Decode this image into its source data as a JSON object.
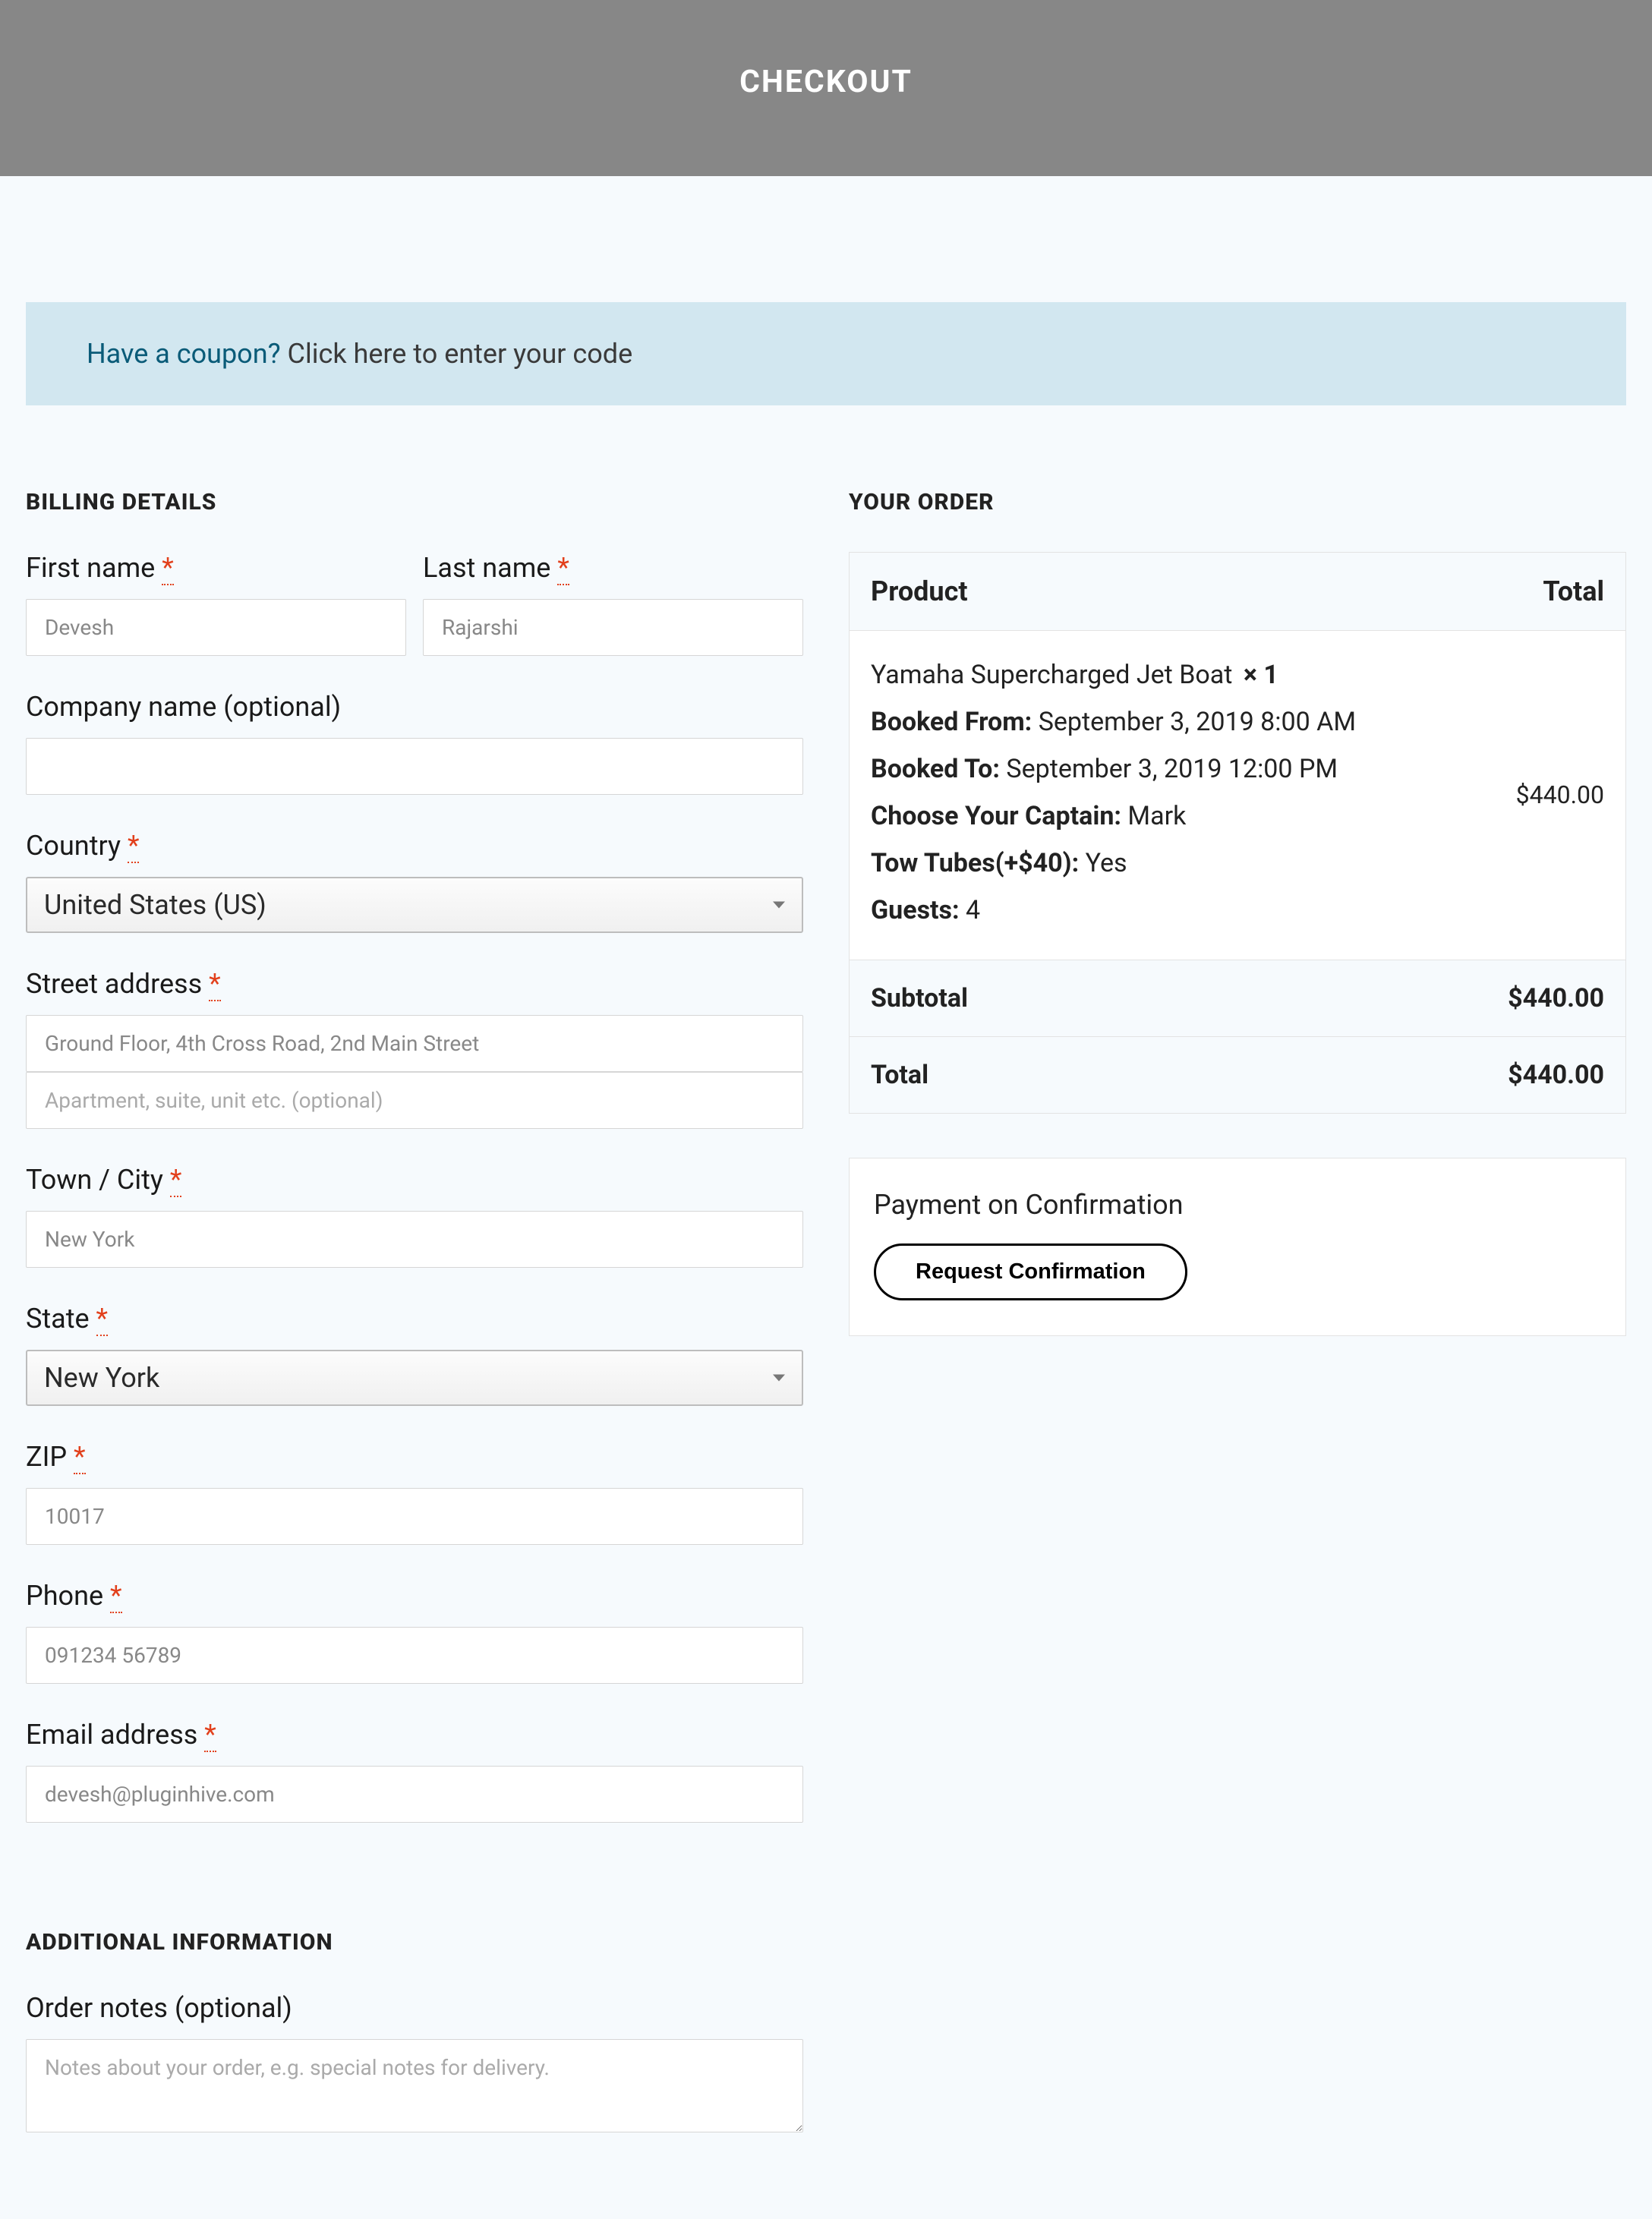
{
  "header": {
    "title": "CHECKOUT"
  },
  "coupon": {
    "link_text": "Have a coupon?",
    "prompt_text": " Click here to enter your code"
  },
  "sections": {
    "billing_title": "BILLING DETAILS",
    "additional_title": "ADDITIONAL INFORMATION",
    "order_title": "YOUR ORDER"
  },
  "billing": {
    "first_name_label": "First name ",
    "first_name_value": "Devesh",
    "last_name_label": "Last name ",
    "last_name_value": "Rajarshi",
    "company_label": "Company name (optional)",
    "company_value": "",
    "country_label": "Country ",
    "country_value": "United States (US)",
    "street_label": "Street address ",
    "street_value_1": "Ground Floor, 4th Cross Road, 2nd Main Street",
    "street_placeholder_2": "Apartment, suite, unit etc. (optional)",
    "city_label": "Town / City ",
    "city_value": "New York",
    "state_label": "State ",
    "state_value": "New York",
    "zip_label": "ZIP ",
    "zip_value": "10017",
    "phone_label": "Phone ",
    "phone_value": "091234 56789",
    "email_label": "Email address ",
    "email_value": "devesh@pluginhive.com",
    "required_mark": "*"
  },
  "additional": {
    "notes_label": "Order notes (optional)",
    "notes_placeholder": "Notes about your order, e.g. special notes for delivery."
  },
  "order": {
    "head_product": "Product",
    "head_total": "Total",
    "product": {
      "name": "Yamaha Supercharged Jet Boat ",
      "qty": " × 1",
      "booked_from_label": "Booked From: ",
      "booked_from_value": "September 3, 2019 8:00 AM",
      "booked_to_label": "Booked To: ",
      "booked_to_value": "September 3, 2019 12:00 PM",
      "captain_label": "Choose Your Captain: ",
      "captain_value": "Mark",
      "tubes_label": "Tow Tubes(+$40): ",
      "tubes_value": "Yes",
      "guests_label": "Guests: ",
      "guests_value": "4",
      "line_total": "$440.00"
    },
    "subtotal_label": "Subtotal",
    "subtotal_value": "$440.00",
    "total_label": "Total",
    "total_value": "$440.00"
  },
  "payment": {
    "title": "Payment on Confirmation",
    "button_label": "Request Confirmation"
  }
}
